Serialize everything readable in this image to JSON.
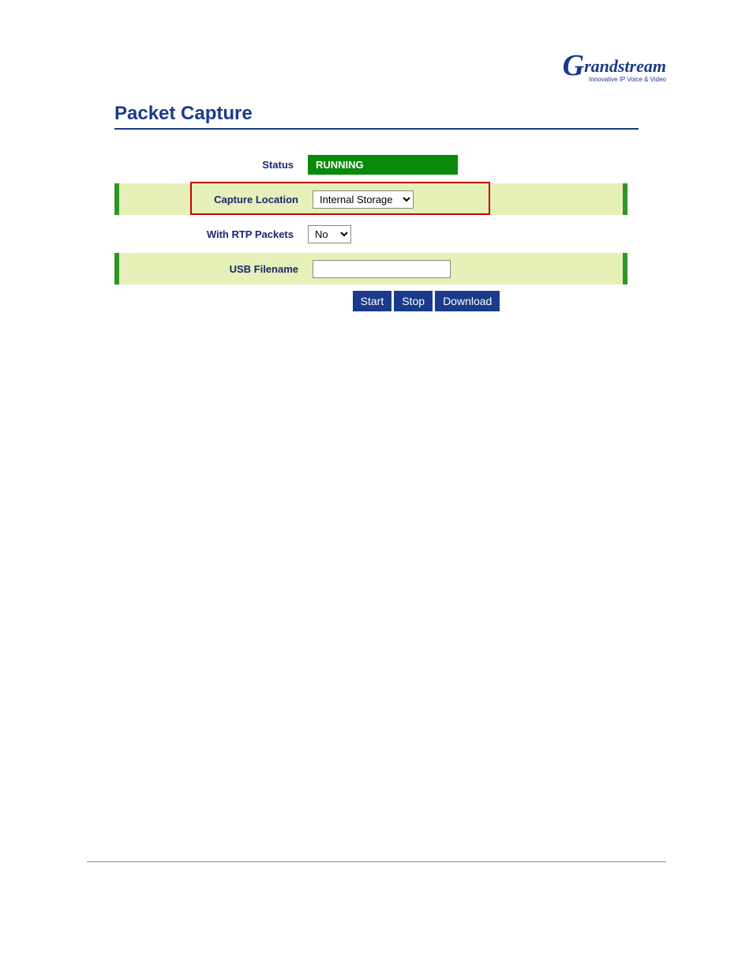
{
  "brand": {
    "name": "Grandstream",
    "tagline": "Innovative IP Voice & Video"
  },
  "page_title": "Packet Capture",
  "rows": {
    "status": {
      "label": "Status",
      "value": "RUNNING"
    },
    "capture_location": {
      "label": "Capture Location",
      "selected": "Internal Storage"
    },
    "with_rtp": {
      "label": "With RTP Packets",
      "selected": "No"
    },
    "usb_filename": {
      "label": "USB Filename",
      "value": ""
    }
  },
  "buttons": {
    "start": "Start",
    "stop": "Stop",
    "download": "Download"
  }
}
